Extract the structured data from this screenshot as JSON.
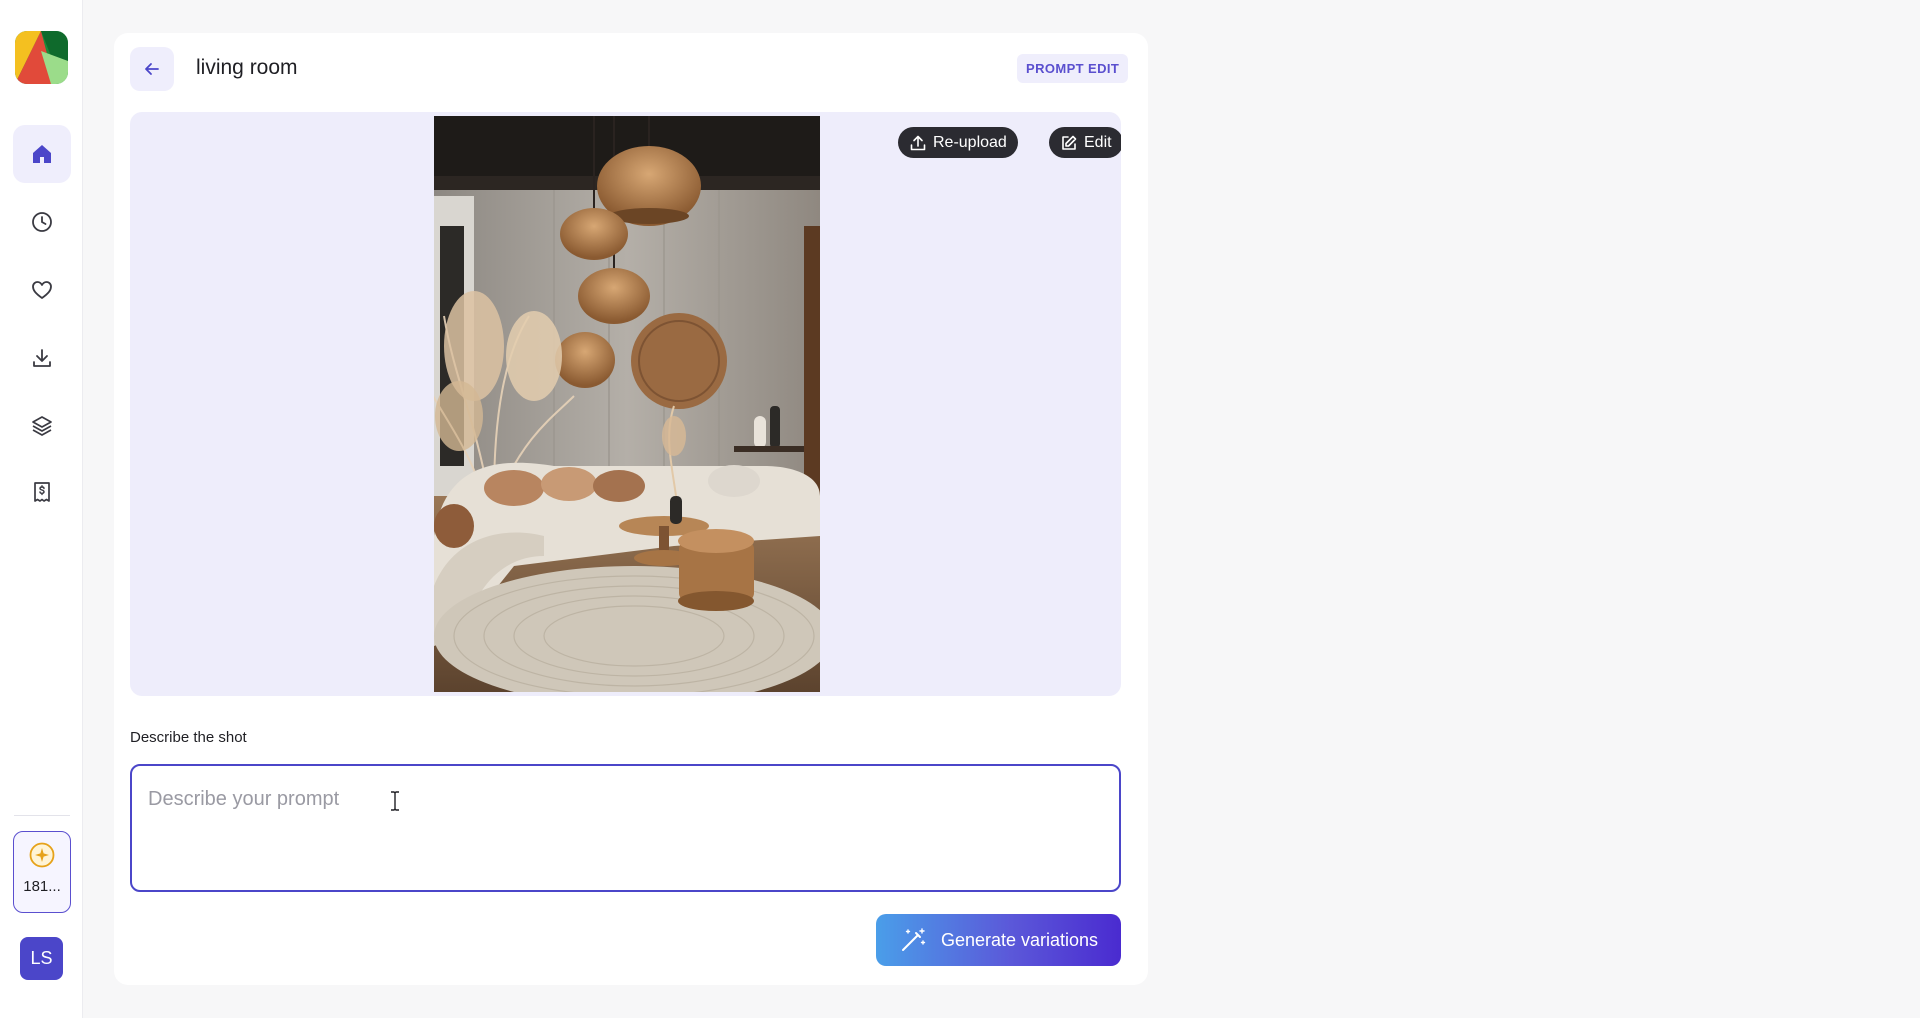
{
  "sidebar": {
    "items": [
      {
        "name": "home",
        "icon": "home-icon",
        "active": true
      },
      {
        "name": "history",
        "icon": "clock-icon",
        "active": false
      },
      {
        "name": "favorites",
        "icon": "heart-icon",
        "active": false
      },
      {
        "name": "downloads",
        "icon": "download-icon",
        "active": false
      },
      {
        "name": "layers",
        "icon": "layers-icon",
        "active": false
      },
      {
        "name": "billing",
        "icon": "receipt-icon",
        "active": false
      }
    ],
    "credits": {
      "count": "181...",
      "icon": "coin-icon"
    },
    "avatar": {
      "initials": "LS"
    }
  },
  "header": {
    "title": "living room",
    "badge": "PROMPT EDIT"
  },
  "image_area": {
    "reupload_label": "Re-upload",
    "edit_label": "Edit"
  },
  "prompt": {
    "label": "Describe the shot",
    "placeholder": "Describe your prompt",
    "value": ""
  },
  "actions": {
    "generate_label": "Generate variations"
  },
  "colors": {
    "accent": "#4b46c9",
    "accent_light": "#efeefc",
    "image_bg": "#eeedfb",
    "button_dark": "#2b2b31"
  }
}
